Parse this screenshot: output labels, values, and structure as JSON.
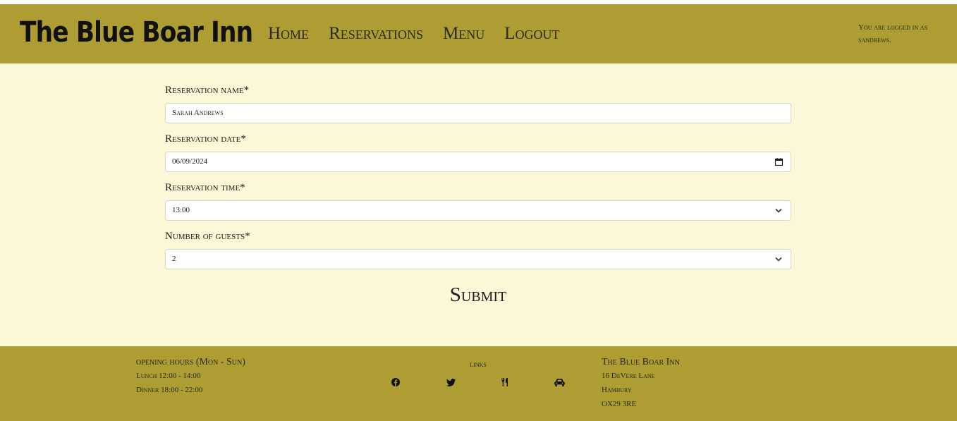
{
  "header": {
    "brand": "The Blue Boar Inn",
    "nav": [
      "Home",
      "Reservations",
      "Menu",
      "Logout"
    ],
    "login_status": "You are logged in as sandrews."
  },
  "form": {
    "fields": [
      {
        "label": "Reservation name*",
        "value": "Sarah Andrews",
        "type": "text"
      },
      {
        "label": "Reservation date*",
        "value": "06/09/2024",
        "type": "date"
      },
      {
        "label": "Reservation time*",
        "value": "13:00",
        "type": "select"
      },
      {
        "label": "Number of guests*",
        "value": "2",
        "type": "select"
      }
    ],
    "submit_label": "Submit"
  },
  "footer": {
    "hours_heading": "opening hours (Mon - Sun)",
    "lunch": "Lunch 12:00 - 14:00",
    "dinner": "Dinner 18:00 - 22:00",
    "links_heading": "links",
    "social_icons": [
      "facebook-icon",
      "twitter-icon",
      "utensils-icon",
      "car-icon"
    ],
    "address_heading": "The Blue Boar Inn",
    "address_lines": [
      "16 DeVere Lane",
      "Hambury",
      "OX29 3RE"
    ]
  },
  "colors": {
    "header_bg": "#ad9d33",
    "page_bg": "#fcf7d7",
    "text": "#1c1c1c"
  }
}
